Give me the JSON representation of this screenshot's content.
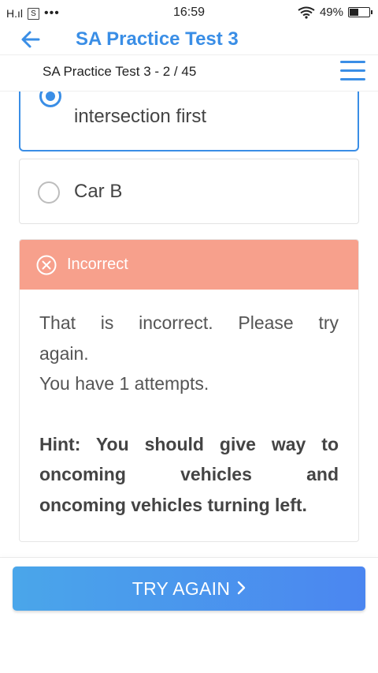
{
  "status_bar": {
    "signal": "H.ıl",
    "sim_badge": "S",
    "dots": "•••",
    "time": "16:59",
    "battery_percent": "49%",
    "battery_level": 0.49
  },
  "header": {
    "title": "SA Practice Test 3",
    "progress": "SA Practice Test 3 - 2 / 45"
  },
  "options": [
    {
      "text": "intersection first",
      "selected": true
    },
    {
      "text": "Car B",
      "selected": false
    }
  ],
  "feedback": {
    "label": "Incorrect",
    "line1": "That is incorrect. Please try",
    "line2": "again.",
    "line3": "You have 1 attempts.",
    "hint1": "Hint: You should give way to",
    "hint2": "oncoming vehicles and",
    "hint3": "oncoming vehicles turning left."
  },
  "buttons": {
    "try_again": "TRY AGAIN",
    "try_again_icon": "chevron-right-icon"
  },
  "colors": {
    "accent": "#3a8ee6",
    "incorrect": "#f7a08c"
  }
}
